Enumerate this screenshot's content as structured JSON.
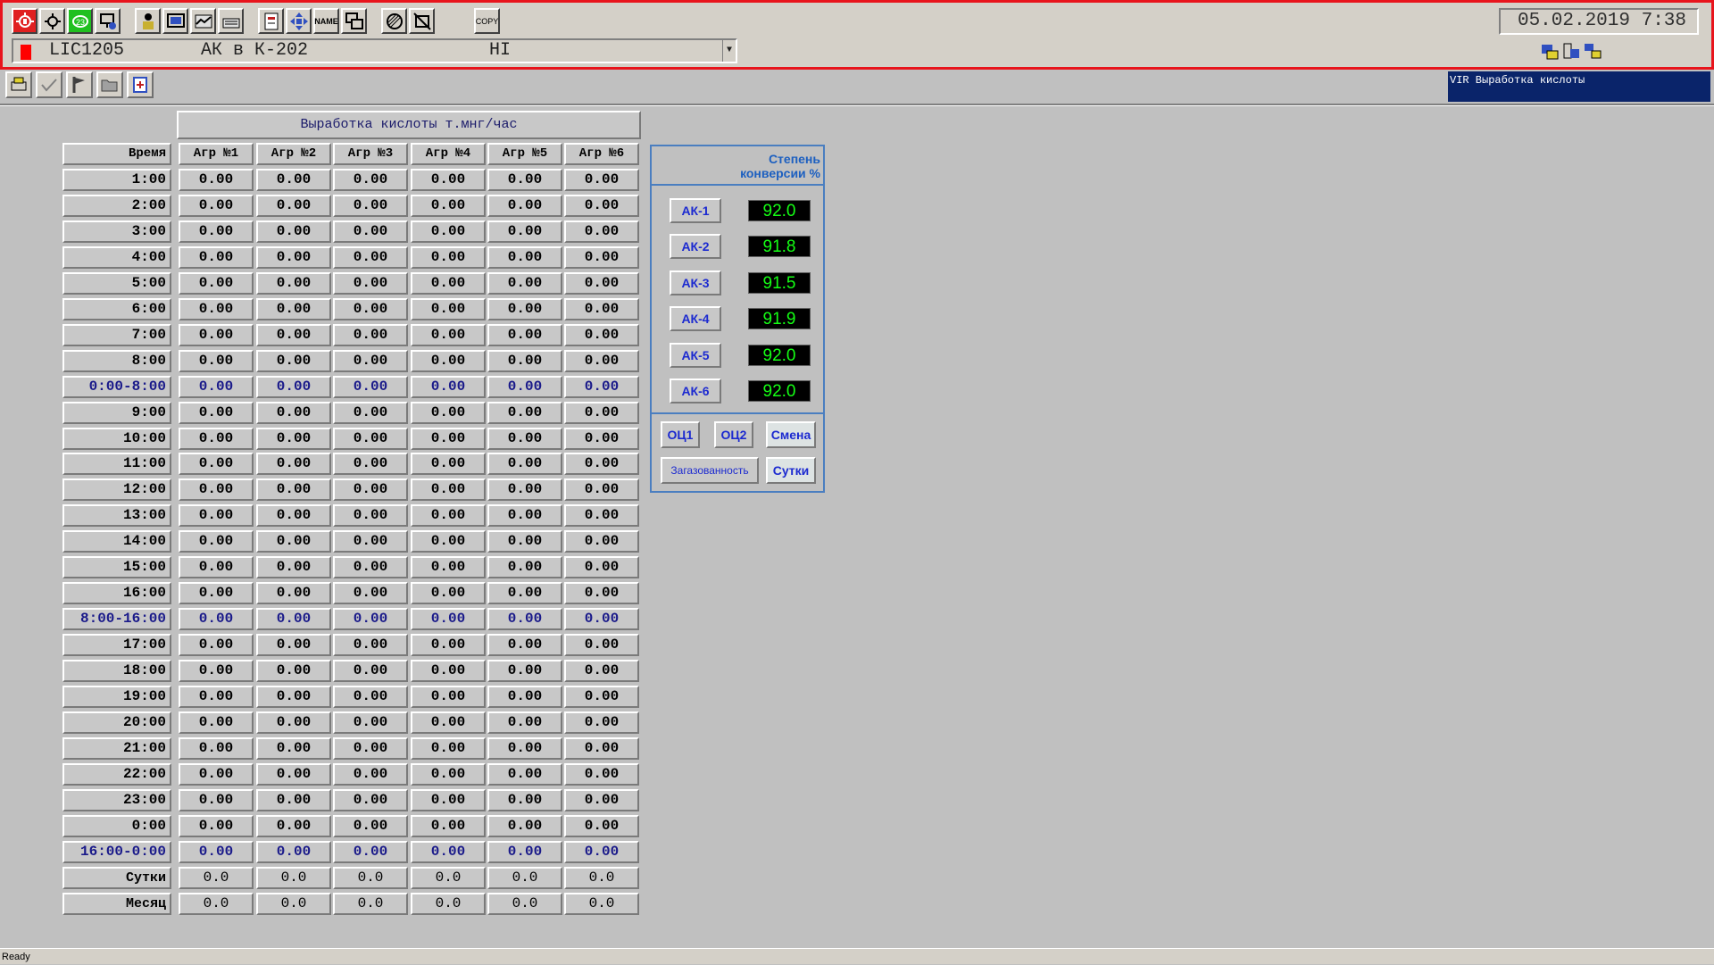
{
  "toolbar1": {
    "buttons": [
      "alarm-bell-icon",
      "gear-bug-icon",
      "alarm-ack-icon",
      "network-icon",
      "operator-icon",
      "display-icon",
      "trend-icon",
      "keyboard-icon",
      "report-icon",
      "navigate-icon",
      "name",
      "group-icon",
      "hatch-icon",
      "crossed-out-icon",
      "copy"
    ],
    "name_label": "NAME",
    "copy_label": "COPY"
  },
  "datetime": "05.02.2019 7:38",
  "alarm": {
    "tag": "LIC1205",
    "desc": "АК в К-202",
    "state": "HI"
  },
  "vir_title": "VIR Выработка кислоты",
  "table": {
    "title": "Выработка кислоты т.мнг/час",
    "time_header": "Время",
    "columns": [
      "Агр №1",
      "Агр №2",
      "Агр №3",
      "Агр №4",
      "Агр №5",
      "Агр №6"
    ],
    "rows": [
      {
        "label": "1:00",
        "values": [
          "0.00",
          "0.00",
          "0.00",
          "0.00",
          "0.00",
          "0.00"
        ],
        "blue": false
      },
      {
        "label": "2:00",
        "values": [
          "0.00",
          "0.00",
          "0.00",
          "0.00",
          "0.00",
          "0.00"
        ],
        "blue": false
      },
      {
        "label": "3:00",
        "values": [
          "0.00",
          "0.00",
          "0.00",
          "0.00",
          "0.00",
          "0.00"
        ],
        "blue": false
      },
      {
        "label": "4:00",
        "values": [
          "0.00",
          "0.00",
          "0.00",
          "0.00",
          "0.00",
          "0.00"
        ],
        "blue": false
      },
      {
        "label": "5:00",
        "values": [
          "0.00",
          "0.00",
          "0.00",
          "0.00",
          "0.00",
          "0.00"
        ],
        "blue": false
      },
      {
        "label": "6:00",
        "values": [
          "0.00",
          "0.00",
          "0.00",
          "0.00",
          "0.00",
          "0.00"
        ],
        "blue": false
      },
      {
        "label": "7:00",
        "values": [
          "0.00",
          "0.00",
          "0.00",
          "0.00",
          "0.00",
          "0.00"
        ],
        "blue": false
      },
      {
        "label": "8:00",
        "values": [
          "0.00",
          "0.00",
          "0.00",
          "0.00",
          "0.00",
          "0.00"
        ],
        "blue": false
      },
      {
        "label": "0:00-8:00",
        "values": [
          "0.00",
          "0.00",
          "0.00",
          "0.00",
          "0.00",
          "0.00"
        ],
        "blue": true
      },
      {
        "label": "9:00",
        "values": [
          "0.00",
          "0.00",
          "0.00",
          "0.00",
          "0.00",
          "0.00"
        ],
        "blue": false
      },
      {
        "label": "10:00",
        "values": [
          "0.00",
          "0.00",
          "0.00",
          "0.00",
          "0.00",
          "0.00"
        ],
        "blue": false
      },
      {
        "label": "11:00",
        "values": [
          "0.00",
          "0.00",
          "0.00",
          "0.00",
          "0.00",
          "0.00"
        ],
        "blue": false
      },
      {
        "label": "12:00",
        "values": [
          "0.00",
          "0.00",
          "0.00",
          "0.00",
          "0.00",
          "0.00"
        ],
        "blue": false
      },
      {
        "label": "13:00",
        "values": [
          "0.00",
          "0.00",
          "0.00",
          "0.00",
          "0.00",
          "0.00"
        ],
        "blue": false
      },
      {
        "label": "14:00",
        "values": [
          "0.00",
          "0.00",
          "0.00",
          "0.00",
          "0.00",
          "0.00"
        ],
        "blue": false
      },
      {
        "label": "15:00",
        "values": [
          "0.00",
          "0.00",
          "0.00",
          "0.00",
          "0.00",
          "0.00"
        ],
        "blue": false
      },
      {
        "label": "16:00",
        "values": [
          "0.00",
          "0.00",
          "0.00",
          "0.00",
          "0.00",
          "0.00"
        ],
        "blue": false
      },
      {
        "label": "8:00-16:00",
        "values": [
          "0.00",
          "0.00",
          "0.00",
          "0.00",
          "0.00",
          "0.00"
        ],
        "blue": true
      },
      {
        "label": "17:00",
        "values": [
          "0.00",
          "0.00",
          "0.00",
          "0.00",
          "0.00",
          "0.00"
        ],
        "blue": false
      },
      {
        "label": "18:00",
        "values": [
          "0.00",
          "0.00",
          "0.00",
          "0.00",
          "0.00",
          "0.00"
        ],
        "blue": false
      },
      {
        "label": "19:00",
        "values": [
          "0.00",
          "0.00",
          "0.00",
          "0.00",
          "0.00",
          "0.00"
        ],
        "blue": false
      },
      {
        "label": "20:00",
        "values": [
          "0.00",
          "0.00",
          "0.00",
          "0.00",
          "0.00",
          "0.00"
        ],
        "blue": false
      },
      {
        "label": "21:00",
        "values": [
          "0.00",
          "0.00",
          "0.00",
          "0.00",
          "0.00",
          "0.00"
        ],
        "blue": false
      },
      {
        "label": "22:00",
        "values": [
          "0.00",
          "0.00",
          "0.00",
          "0.00",
          "0.00",
          "0.00"
        ],
        "blue": false
      },
      {
        "label": "23:00",
        "values": [
          "0.00",
          "0.00",
          "0.00",
          "0.00",
          "0.00",
          "0.00"
        ],
        "blue": false
      },
      {
        "label": "0:00",
        "values": [
          "0.00",
          "0.00",
          "0.00",
          "0.00",
          "0.00",
          "0.00"
        ],
        "blue": false
      },
      {
        "label": "16:00-0:00",
        "values": [
          "0.00",
          "0.00",
          "0.00",
          "0.00",
          "0.00",
          "0.00"
        ],
        "blue": true
      },
      {
        "label": "Сутки",
        "values": [
          "0.0",
          "0.0",
          "0.0",
          "0.0",
          "0.0",
          "0.0"
        ],
        "blue": false,
        "normal": true
      },
      {
        "label": "Месяц",
        "values": [
          "0.0",
          "0.0",
          "0.0",
          "0.0",
          "0.0",
          "0.0"
        ],
        "blue": false,
        "normal": true
      }
    ]
  },
  "conversion": {
    "title_line1": "Степень",
    "title_line2": "конверсии %",
    "items": [
      {
        "label": "АК-1",
        "value": "92.0"
      },
      {
        "label": "АК-2",
        "value": "91.8"
      },
      {
        "label": "АК-3",
        "value": "91.5"
      },
      {
        "label": "АК-4",
        "value": "91.9"
      },
      {
        "label": "АК-5",
        "value": "92.0"
      },
      {
        "label": "АК-6",
        "value": "92.0"
      }
    ],
    "nav": {
      "oc1": "ОЦ1",
      "oc2": "ОЦ2",
      "shift": "Смена",
      "gas": "Загазованность",
      "day": "Сутки"
    }
  },
  "status": "Ready",
  "colors": {
    "alarm_border": "#e8141c",
    "value_green": "#14ff14",
    "button_blue": "#1c2ad0",
    "panel_border": "#4a7ec0"
  }
}
